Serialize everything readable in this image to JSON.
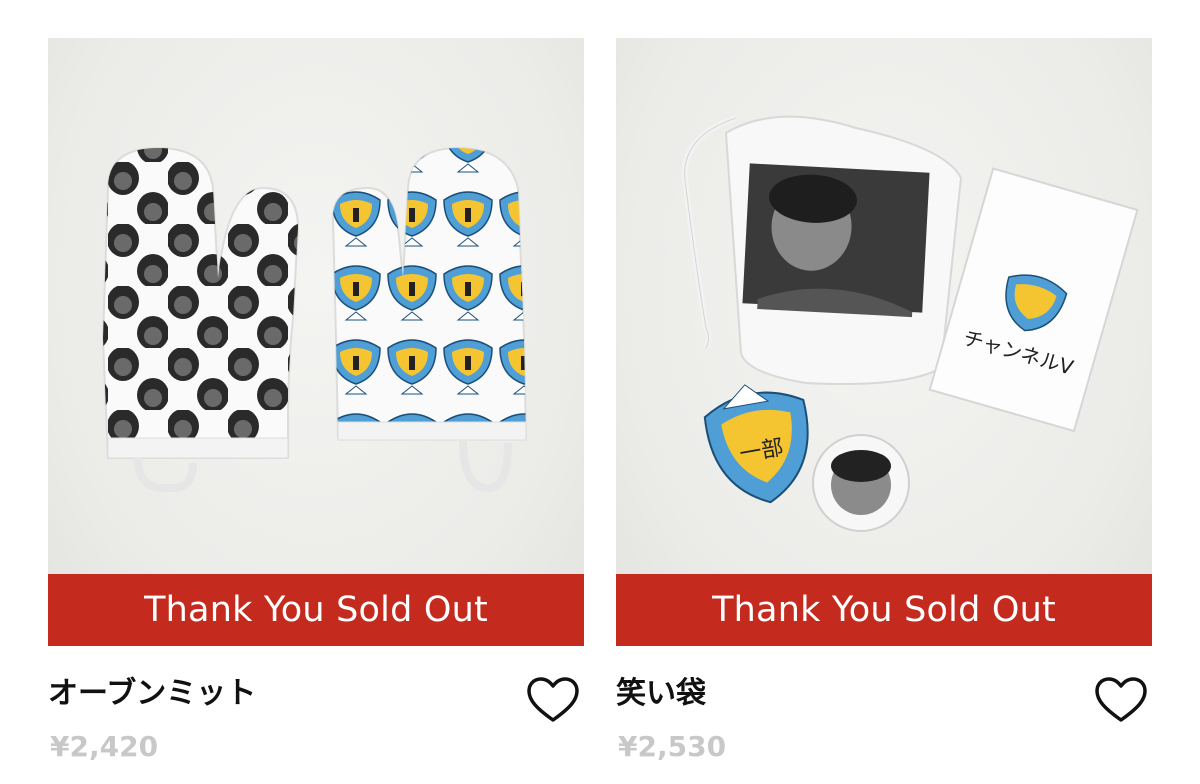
{
  "products": [
    {
      "name": "オーブンミット",
      "price": "¥2,420",
      "badge": "Thank You Sold Out",
      "image_icon": "oven-mitt-pair-icon"
    },
    {
      "name": "笑い袋",
      "price": "¥2,530",
      "badge": "Thank You Sold Out",
      "image_icon": "drawstring-bag-set-icon",
      "box_brand_text": "チャンネルV",
      "sticker_kanji": "一部"
    }
  ],
  "colors": {
    "badge_bg": "#c42b1e",
    "price_text": "#c8c8c8",
    "name_text": "#111111",
    "mouth_blue": "#4f9fd6",
    "mouth_yellow": "#f4c531"
  },
  "favorite_icon": "heart-outline-icon"
}
